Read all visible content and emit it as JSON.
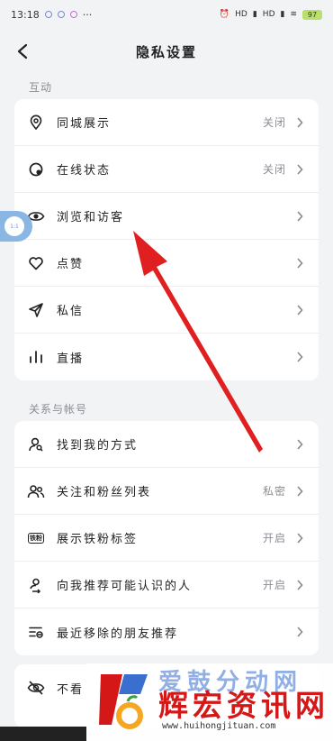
{
  "status_bar": {
    "time": "13:18",
    "dots": "···",
    "signal1": "HD",
    "signal2": "HD",
    "battery": "97"
  },
  "header": {
    "title": "隐私设置",
    "back_icon": "chevron-left-icon"
  },
  "sections": [
    {
      "label": "互动",
      "items": [
        {
          "icon": "location-pin-icon",
          "label": "同城展示",
          "value": "关闭"
        },
        {
          "icon": "online-status-icon",
          "label": "在线状态",
          "value": "关闭"
        },
        {
          "icon": "eye-icon",
          "label": "浏览和访客",
          "value": ""
        },
        {
          "icon": "heart-icon",
          "label": "点赞",
          "value": ""
        },
        {
          "icon": "send-icon",
          "label": "私信",
          "value": ""
        },
        {
          "icon": "bar-chart-icon",
          "label": "直播",
          "value": ""
        }
      ]
    },
    {
      "label": "关系与帐号",
      "items": [
        {
          "icon": "find-user-icon",
          "label": "找到我的方式",
          "value": ""
        },
        {
          "icon": "users-icon",
          "label": "关注和粉丝列表",
          "value": "私密"
        },
        {
          "icon": "fan-tag-icon",
          "label": "展示铁粉标签",
          "value": "开启",
          "tag": "铁粉"
        },
        {
          "icon": "recommend-user-icon",
          "label": "向我推荐可能认识的人",
          "value": "开启"
        },
        {
          "icon": "removed-list-icon",
          "label": "最近移除的朋友推荐",
          "value": ""
        }
      ]
    },
    {
      "label": "",
      "items": [
        {
          "icon": "eye-off-icon",
          "label": "不看",
          "value": ""
        }
      ]
    }
  ],
  "floating_bubble": {
    "text": "1:1"
  },
  "watermark": {
    "top_text": "爱鼓分动网",
    "main_text": "辉宏资讯网",
    "url": "www.huihongjituan.com"
  },
  "colors": {
    "background": "#f2f3f5",
    "card": "#ffffff",
    "annotation_arrow": "#e02020",
    "watermark_red": "#d41818"
  }
}
